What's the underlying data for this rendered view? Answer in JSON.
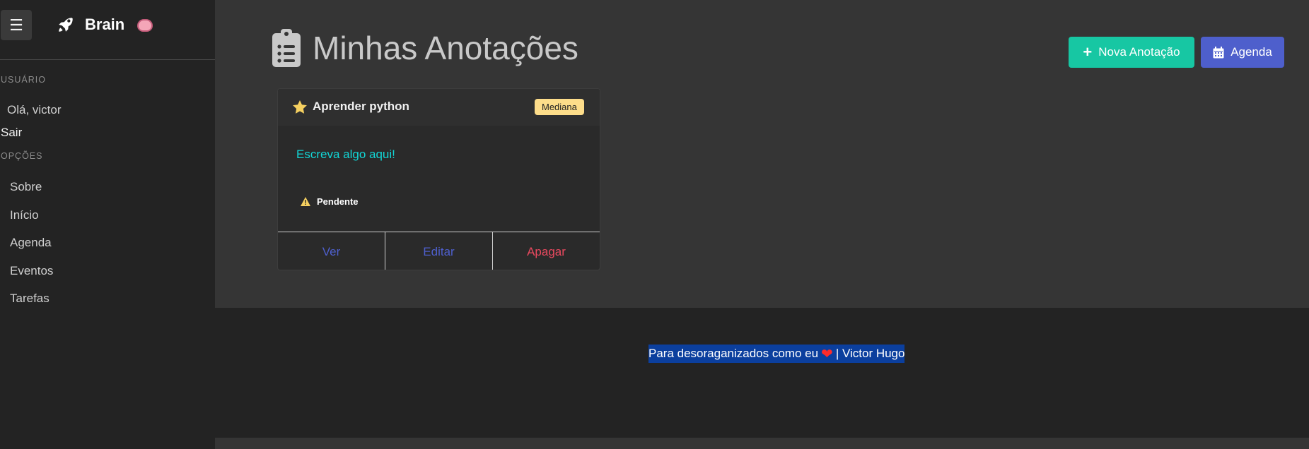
{
  "sidebar": {
    "brand": "Brain",
    "user_section_label": "USUÁRIO",
    "greeting": "Olá, victor",
    "logout": "Sair",
    "options_section_label": "OPÇÕES",
    "items": [
      {
        "label": "Sobre"
      },
      {
        "label": "Início"
      },
      {
        "label": "Agenda"
      },
      {
        "label": "Eventos"
      },
      {
        "label": "Tarefas"
      }
    ]
  },
  "main": {
    "title": "Minhas Anotações",
    "new_button": "Nova Anotação",
    "agenda_button": "Agenda",
    "card": {
      "title": "Aprender python",
      "priority": "Mediana",
      "text": "Escreva algo aqui!",
      "status": "Pendente",
      "actions": {
        "view": "Ver",
        "edit": "Editar",
        "delete": "Apagar"
      }
    }
  },
  "footer": {
    "text_before": "Para desoraganizados como eu",
    "text_after": "| Victor Hugo"
  },
  "colors": {
    "accent_teal": "#17c7a3",
    "accent_blue": "#4e5fcc",
    "danger": "#e9495f",
    "highlight": "#0b3f9e"
  }
}
